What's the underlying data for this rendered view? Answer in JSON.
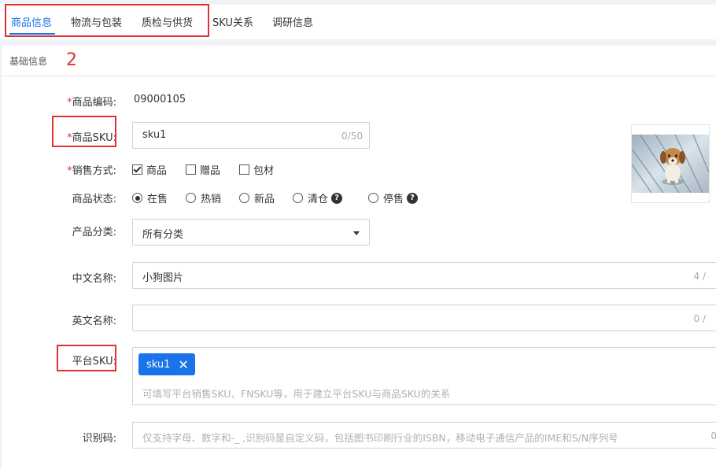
{
  "tabs": [
    {
      "label": "商品信息",
      "active": true
    },
    {
      "label": "物流与包装",
      "active": false
    },
    {
      "label": "质检与供货",
      "active": false
    },
    {
      "label": "SKU关系",
      "active": false
    },
    {
      "label": "调研信息",
      "active": false
    }
  ],
  "section": {
    "title": "基础信息",
    "annotation_number": "2"
  },
  "fields": {
    "product_code": {
      "required_mark": "*",
      "label": "商品编码:",
      "value": "09000105"
    },
    "product_sku": {
      "required_mark": "*",
      "label": "商品SKU:",
      "value": "sku1",
      "counter": "0/50"
    },
    "sale_method": {
      "required_mark": "*",
      "label": "销售方式:",
      "options": [
        {
          "label": "商品",
          "checked": true
        },
        {
          "label": "赠品",
          "checked": false
        },
        {
          "label": "包材",
          "checked": false
        }
      ]
    },
    "product_status": {
      "label": "商品状态:",
      "options": [
        {
          "label": "在售",
          "selected": true
        },
        {
          "label": "热销",
          "selected": false
        },
        {
          "label": "新品",
          "selected": false
        },
        {
          "label": "清仓",
          "selected": false,
          "help": "?"
        },
        {
          "label": "停售",
          "selected": false,
          "help": "?"
        }
      ]
    },
    "category": {
      "label": "产品分类:",
      "value": "所有分类"
    },
    "cn_name": {
      "label": "中文名称:",
      "value": "小狗图片",
      "counter": "4 /"
    },
    "en_name": {
      "label": "英文名称:",
      "value": "",
      "counter": "0 /"
    },
    "platform_sku": {
      "label": "平台SKU:",
      "tags": [
        "sku1"
      ],
      "placeholder": "可填写平台销售SKU、FNSKU等，用于建立平台SKU与商品SKU的关系"
    },
    "identifier": {
      "label": "识别码:",
      "placeholder": "仅支持字母、数字和-_ ,识别码是自定义码，包括图书印刷行业的ISBN，移动电子通信产品的IME和S/N序列号",
      "counter": "0"
    }
  },
  "tag_remove_symbol": "✕",
  "image": {
    "subject": "puppy-photo"
  },
  "colors": {
    "accent": "#1a73e8",
    "required": "#e03131",
    "annotation": "#e03131"
  }
}
